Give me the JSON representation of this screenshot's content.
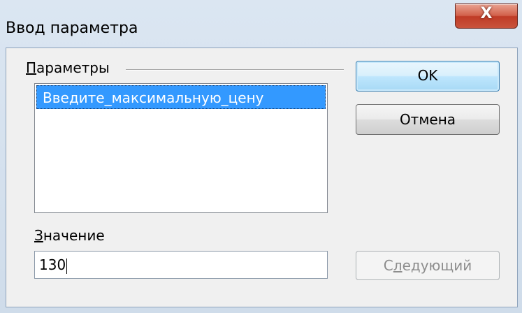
{
  "window": {
    "title": "Ввод параметра",
    "close_glyph": "X"
  },
  "parameters_group": {
    "label_mnemonic": "П",
    "label_rest": "араметры",
    "items": [
      {
        "label": "Введите_максимальную_цену",
        "selected": true
      }
    ]
  },
  "value_section": {
    "label_mnemonic": "З",
    "label_rest": "начение",
    "value": "130"
  },
  "buttons": {
    "ok_label": "OK",
    "cancel_label": "Отмена",
    "next_label_pre": "С",
    "next_label_mnemonic": "л",
    "next_label_rest": "едующий",
    "next_enabled": false
  },
  "colors": {
    "selection": "#3399ff",
    "close_button": "#c9533c",
    "disabled_text": "#8d8d8d"
  },
  "icons": [
    "close-icon"
  ]
}
